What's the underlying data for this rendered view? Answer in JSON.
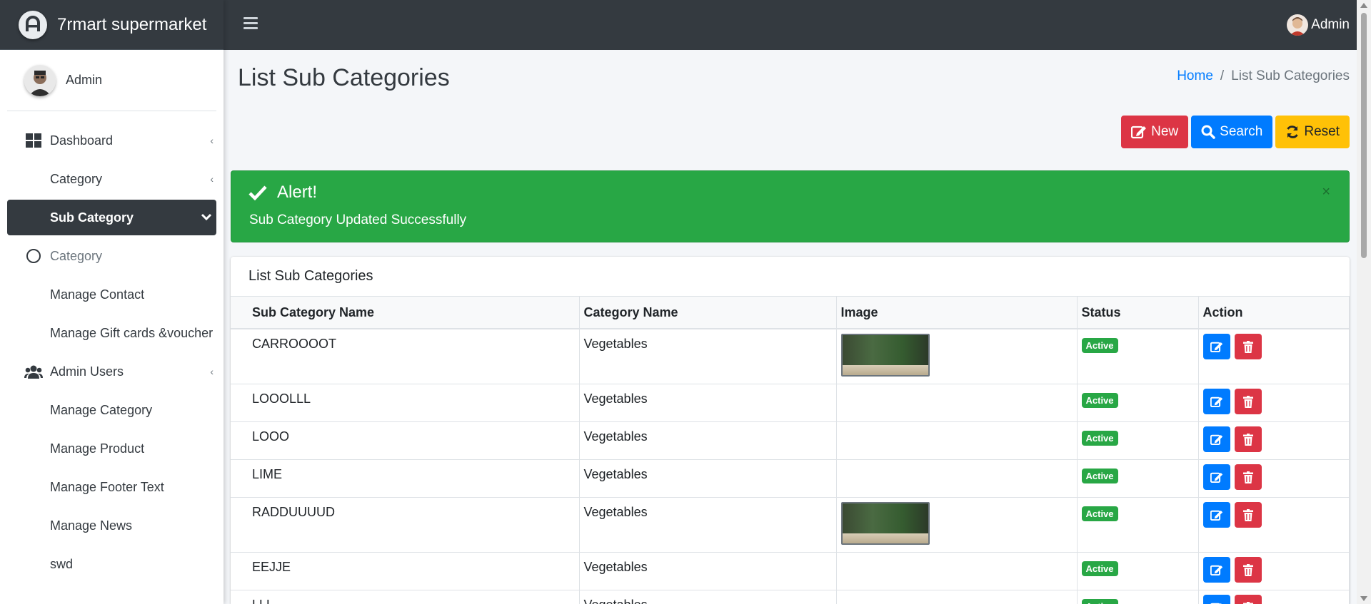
{
  "brand": {
    "name": "7rmart supermarket"
  },
  "user": {
    "name": "Admin"
  },
  "topbar": {
    "user_label": "Admin"
  },
  "sidebar": {
    "items": [
      {
        "label": "Dashboard"
      },
      {
        "label": "Category"
      },
      {
        "label": "Sub Category"
      },
      {
        "label": "Category"
      },
      {
        "label": "Manage Contact"
      },
      {
        "label": "Manage Gift cards &voucher"
      },
      {
        "label": "Admin Users"
      },
      {
        "label": "Manage Category"
      },
      {
        "label": "Manage Product"
      },
      {
        "label": "Manage Footer Text"
      },
      {
        "label": "Manage News"
      },
      {
        "label": "swd"
      }
    ]
  },
  "page": {
    "title": "List Sub Categories"
  },
  "breadcrumb": {
    "home": "Home",
    "current": "List Sub Categories"
  },
  "buttons": {
    "new": "New",
    "search": "Search",
    "reset": "Reset"
  },
  "alert": {
    "title": "Alert!",
    "message": "Sub Category Updated Successfully",
    "close": "×"
  },
  "card": {
    "title": "List Sub Categories"
  },
  "table": {
    "headers": [
      "Sub Category Name",
      "Category Name",
      "Image",
      "Status",
      "Action"
    ],
    "rows": [
      {
        "name": "CARROOOOT",
        "category": "Vegetables",
        "has_image": true,
        "status": "Active"
      },
      {
        "name": "LOOOLLL",
        "category": "Vegetables",
        "has_image": false,
        "status": "Active"
      },
      {
        "name": "LOOO",
        "category": "Vegetables",
        "has_image": false,
        "status": "Active"
      },
      {
        "name": "LIME",
        "category": "Vegetables",
        "has_image": false,
        "status": "Active"
      },
      {
        "name": "RADDUUUUD",
        "category": "Vegetables",
        "has_image": true,
        "status": "Active"
      },
      {
        "name": "EEJJE",
        "category": "Vegetables",
        "has_image": false,
        "status": "Active"
      },
      {
        "name": "LLL",
        "category": "Vegetables",
        "has_image": false,
        "status": "Active"
      }
    ]
  },
  "colors": {
    "topbar": "#343a40",
    "success": "#28a745",
    "primary": "#007bff",
    "danger": "#dc3545",
    "warning": "#ffc107"
  }
}
